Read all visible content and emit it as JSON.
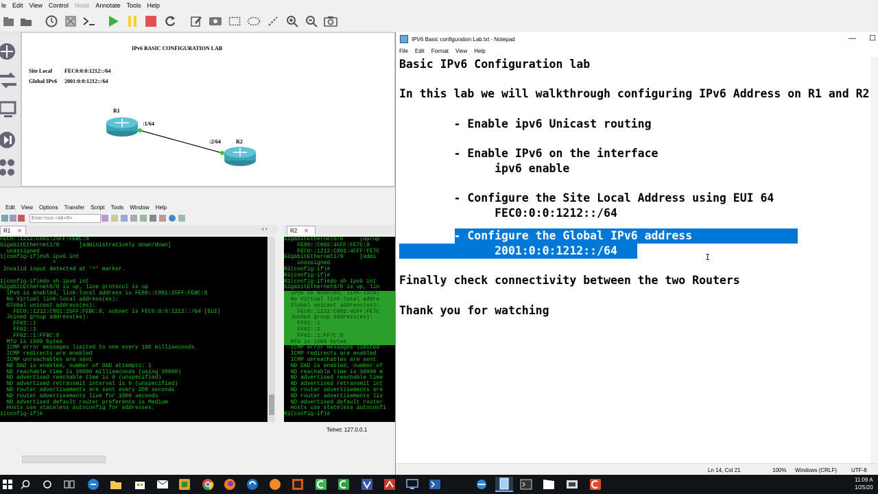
{
  "gns3": {
    "menu": [
      "Edit",
      "View",
      "Control",
      "Node",
      "Annotate",
      "Tools",
      "Help"
    ],
    "menu_partial_first": "le",
    "topology": {
      "title": "IPv6 BASIC CONFIGURATION LAB",
      "site_local_label": "Site Local",
      "site_local_value": "FEC0:0:0:1212::/64",
      "global_label": "Global IPv6",
      "global_value": "2001:0:0:1212::/64",
      "r1_name": "R1",
      "r2_name": "R2",
      "r1_iface": ":1/64",
      "r2_iface": ":2/64"
    }
  },
  "crt": {
    "menu": [
      "Edit",
      "View",
      "Options",
      "Transfer",
      "Script",
      "Tools",
      "Window",
      "Help"
    ],
    "host_placeholder": "Enter host <Alt+R>",
    "tab_r1": "R1",
    "tab_r2": "R2",
    "status": "Telnet: 127.0.0.1",
    "term_r1": [
      "FEC0::1212:C801:25FF:FEBC:8",
      "GigabitEthernet1/0      [administratively down/down]",
      "  unassigned",
      "1(config-if)#sh ipv6 int",
      "                ^",
      " Invalid input detected at '^' marker.",
      "",
      "1(config-if)#do sh ipv6 int",
      "GigabitEthernet0/0 is up, line protocol is up",
      "  IPv6 is enabled, link-local address is FE80::C801:25FF:FEBC:8",
      "  No Virtual link-local address(es):",
      "  Global unicast address(es):",
      "    FEC0::1212:C801:25FF:FEBC:8, subnet is FEC0:0:0:1212::/64 [EUI]",
      "  Joined group address(es):",
      "    FF02::1",
      "    FF02::2",
      "    FF02::1:FFBC:8",
      "  MTU is 1500 bytes",
      "  ICMP error messages limited to one every 100 milliseconds",
      "  ICMP redirects are enabled",
      "  ICMP unreachables are sent",
      "  ND DAD is enabled, number of DAD attempts: 1",
      "  ND reachable time is 30000 milliseconds (using 30000)",
      "  ND advertised reachable time is 0 (unspecified)",
      "  ND advertised retransmit interval is 0 (unspecified)",
      "  ND router advertisements are sent every 200 seconds",
      "  ND router advertisements live for 1800 seconds",
      "  ND advertised default router preference is Medium",
      "  Hosts use stateless autoconfig for addresses.",
      "1(config-if)#"
    ],
    "term_r2": [
      "GigabitEthernet0/0     [up/up",
      "    FE80::C802:4CFF:FE7C:8",
      "    FEC0::1212:C802:4CFF:FE7C",
      "GigabitEthernet1/0     [admi",
      "    unassigned",
      "R2(config-if)#",
      "R2(config-if)#",
      "R2(config-if)#do sh ipv6 int",
      "GigabitEthernet0/0 is up, lin",
      "  IPv6 is enabled, link-local",
      "  No Virtual link-local addre",
      "  Global unicast address(es):",
      "    FEC0::1212:C802:4CFF:FE7C",
      "  Joined group address(es):",
      "    FF02::1",
      "    FF02::2",
      "    FF02::1:FF7C:8",
      "  MTU is 1500 bytes",
      "  ICMP error messages limited",
      "  ICMP redirects are enabled",
      "  ICMP unreachables are sent",
      "  ND DAD is enabled, number of",
      "  ND reachable time is 30000 m",
      "  ND advertised reachable time",
      "  ND advertised retransmit int",
      "  ND router advertisements are",
      "  ND router advertisements liv",
      "  ND advertised default router",
      "  Hosts use stateless autoconfi",
      "R2(config-if)#"
    ]
  },
  "notepad": {
    "title": "IPV6 Basic configuration Lab.txt - Notepad",
    "menu": [
      "File",
      "Edit",
      "Format",
      "View",
      "Help"
    ],
    "lines": [
      "Basic IPv6 Configuration lab",
      "",
      "In this lab we will walkthrough configuring IPv6 Address on R1 and R2",
      "",
      "        - Enable ipv6 Unicast routing",
      "",
      "        - Enable IPv6 on the interface",
      "              ipv6 enable",
      "",
      "        - Configure the Site Local Address using EUI 64",
      "              FEC0:0:0:1212::/64",
      "",
      "        - Configure the Global IPv6 address",
      "              2001:0:0:1212::/64",
      "",
      "Finally check connectivity between the two Routers",
      "",
      "Thank you for watching"
    ],
    "status_pos": "Ln 14, Col 21",
    "status_zoom": "100%",
    "status_eol": "Windows (CRLF)",
    "status_enc": "UTF-8"
  },
  "taskbar": {
    "time": "11:09 A",
    "date": "1/25/20"
  }
}
